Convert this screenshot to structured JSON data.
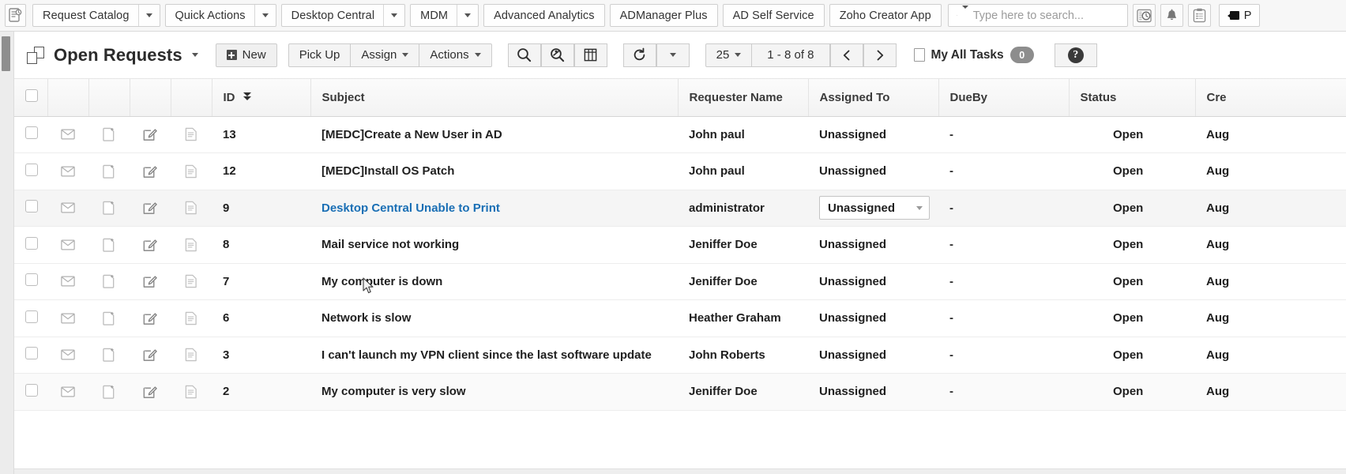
{
  "topbar": {
    "logo_icon": "servicedesk-logo-icon",
    "menu_buttons": [
      {
        "label": "Request Catalog",
        "has_caret": true
      },
      {
        "label": "Quick Actions",
        "has_caret": true
      },
      {
        "label": "Desktop Central",
        "has_caret": true
      },
      {
        "label": "MDM",
        "has_caret": true
      },
      {
        "label": "Advanced Analytics",
        "has_caret": false
      },
      {
        "label": "ADManager Plus",
        "has_caret": false
      },
      {
        "label": "AD Self Service",
        "has_caret": false
      },
      {
        "label": "Zoho Creator App",
        "has_caret": false
      }
    ],
    "search": {
      "placeholder": "Type here to search...",
      "value": "",
      "icon": "search-icon",
      "caret_icon": "chevron-down-icon"
    },
    "right_icons": [
      {
        "name": "history-clock-icon"
      },
      {
        "name": "bell-notification-icon"
      },
      {
        "name": "clipboard-tasks-icon"
      }
    ],
    "record_button": {
      "label": "P",
      "icon": "video-camera-icon"
    }
  },
  "list_toolbar": {
    "view_icon": "stacked-pages-icon",
    "view_name": "Open Requests",
    "view_caret": "chevron-down-icon",
    "new_label": "New",
    "new_icon": "plus-square-icon",
    "pick_up_label": "Pick Up",
    "assign_label": "Assign",
    "actions_label": "Actions",
    "search_icon": "magnifier-icon",
    "advanced_search_icon": "advanced-search-icon",
    "columns_icon": "table-columns-icon",
    "refresh_icon": "refresh-icon",
    "refresh_caret_icon": "chevron-down-icon",
    "page_size": "25",
    "page_size_caret": "chevron-down-icon",
    "range_label": "1 - 8 of 8",
    "prev_icon": "chevron-left-icon",
    "next_icon": "chevron-right-icon",
    "my_tasks_icon": "document-icon",
    "my_tasks_label": "My All Tasks",
    "my_tasks_count": "0",
    "help_icon": "question-mark-icon"
  },
  "table": {
    "headers": {
      "select_all": "",
      "col_mail": "",
      "col_note": "",
      "col_edit": "",
      "col_doc": "",
      "id": "ID",
      "id_sort_icon": "double-chevron-down-icon",
      "subject": "Subject",
      "requester_name": "Requester Name",
      "assigned_to": "Assigned To",
      "dueby": "DueBy",
      "status": "Status",
      "created": "Cre"
    },
    "row_icons": {
      "mail": "envelope-icon",
      "note": "add-note-icon",
      "edit": "edit-pencil-icon",
      "doc": "document-lines-icon"
    },
    "rows": [
      {
        "id": "13",
        "subject": "[MEDC]Create a New User in AD",
        "is_link": false,
        "requester": "John paul",
        "assigned_to": "Unassigned",
        "assigned_is_select": false,
        "dueby": "-",
        "status": "Open",
        "created": "Aug",
        "state": "normal"
      },
      {
        "id": "12",
        "subject": "[MEDC]Install OS Patch",
        "is_link": false,
        "requester": "John paul",
        "assigned_to": "Unassigned",
        "assigned_is_select": false,
        "dueby": "-",
        "status": "Open",
        "created": "Aug",
        "state": "normal"
      },
      {
        "id": "9",
        "subject": "Desktop Central Unable to Print",
        "is_link": true,
        "requester": "administrator",
        "assigned_to": "Unassigned",
        "assigned_is_select": true,
        "dueby": "-",
        "status": "Open",
        "created": "Aug",
        "state": "hover"
      },
      {
        "id": "8",
        "subject": "Mail service not working",
        "is_link": false,
        "requester": "Jeniffer Doe",
        "assigned_to": "Unassigned",
        "assigned_is_select": false,
        "dueby": "-",
        "status": "Open",
        "created": "Aug",
        "state": "normal"
      },
      {
        "id": "7",
        "subject": "My computer is down",
        "is_link": false,
        "requester": "Jeniffer Doe",
        "assigned_to": "Unassigned",
        "assigned_is_select": false,
        "dueby": "-",
        "status": "Open",
        "created": "Aug",
        "state": "normal"
      },
      {
        "id": "6",
        "subject": "Network is slow",
        "is_link": false,
        "requester": "Heather Graham",
        "assigned_to": "Unassigned",
        "assigned_is_select": false,
        "dueby": "-",
        "status": "Open",
        "created": "Aug",
        "state": "normal"
      },
      {
        "id": "3",
        "subject": "I can't launch my VPN client since the last software update",
        "is_link": false,
        "requester": "John Roberts",
        "assigned_to": "Unassigned",
        "assigned_is_select": false,
        "dueby": "-",
        "status": "Open",
        "created": "Aug",
        "state": "normal"
      },
      {
        "id": "2",
        "subject": "My computer is very slow",
        "is_link": false,
        "requester": "Jeniffer Doe",
        "assigned_to": "Unassigned",
        "assigned_is_select": false,
        "dueby": "-",
        "status": "Open",
        "created": "Aug",
        "state": "tinted"
      }
    ]
  },
  "colors": {
    "link": "#1a6fb5",
    "toolbar_bg": "#f7f7f7",
    "badge_bg": "#8d8d8d"
  }
}
